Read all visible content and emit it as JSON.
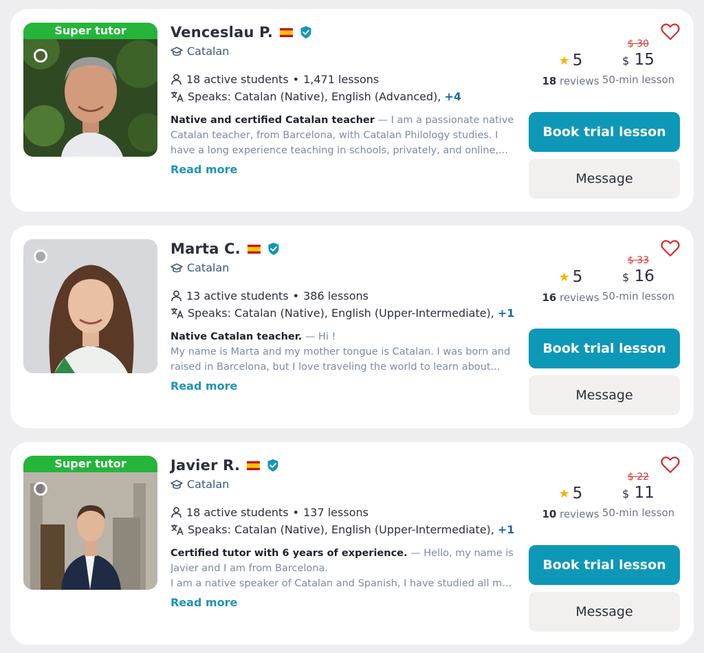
{
  "tutors": [
    {
      "super_tutor": "Super tutor",
      "name": "Venceslau P.",
      "subject": "Catalan",
      "active_students": "18 active students",
      "separator": "•",
      "lessons": "1,471 lessons",
      "speaks": "Speaks: Catalan (Native), English (Advanced),",
      "more_languages": "+4",
      "headline": "Native and certified Catalan teacher",
      "bio_line1": " — I am a passionate native",
      "bio_line2": "Catalan teacher, from Barcelona, with Catalan Philology studies. I",
      "bio_line3": "have a long experience teaching in schools, privately, and online,...",
      "read_more": "Read more",
      "rating": "5",
      "reviews_count": "18",
      "reviews_label": "reviews",
      "old_price": "$ 30",
      "currency": "$",
      "price": "15",
      "duration": "50-min lesson",
      "book_label": "Book trial lesson",
      "message_label": "Message"
    },
    {
      "super_tutor": "",
      "name": "Marta C.",
      "subject": "Catalan",
      "active_students": "13 active students",
      "separator": "•",
      "lessons": "386 lessons",
      "speaks": "Speaks: Catalan (Native), English (Upper-Intermediate),",
      "more_languages": "+1",
      "headline": "Native Catalan teacher.",
      "bio_line1": " — Hi !",
      "bio_line2": "My name is Marta and my mother tongue is Catalan. I was born and",
      "bio_line3": "raised in Barcelona, but I love traveling the world to learn about...",
      "read_more": "Read more",
      "rating": "5",
      "reviews_count": "16",
      "reviews_label": "reviews",
      "old_price": "$ 33",
      "currency": "$",
      "price": "16",
      "duration": "50-min lesson",
      "book_label": "Book trial lesson",
      "message_label": "Message"
    },
    {
      "super_tutor": "Super tutor",
      "name": "Javier R.",
      "subject": "Catalan",
      "active_students": "18 active students",
      "separator": "•",
      "lessons": "137 lessons",
      "speaks": "Speaks: Catalan (Native), English (Upper-Intermediate),",
      "more_languages": "+1",
      "headline": "Certified tutor with 6 years of experience.",
      "bio_line1": " — Hello, my name is",
      "bio_line2": "Javier and I am from Barcelona.",
      "bio_line3": "I am a native speaker of Catalan and Spanish, I have studied all m...",
      "read_more": "Read more",
      "rating": "5",
      "reviews_count": "10",
      "reviews_label": "reviews",
      "old_price": "$ 22",
      "currency": "$",
      "price": "11",
      "duration": "50-min lesson",
      "book_label": "Book trial lesson",
      "message_label": "Message"
    }
  ],
  "icons": {
    "flag": "spain-flag-icon",
    "verified": "verified-shield-icon",
    "subject": "graduation-cap-icon",
    "students": "person-icon",
    "languages": "translate-icon",
    "star": "star-icon",
    "favorite": "heart-icon"
  },
  "colors": {
    "brand_button": "#0e98b7",
    "super_tutor_badge": "#25b53a",
    "old_price": "#dd3333",
    "star": "#f6b400",
    "heart": "#d62b2b",
    "link": "#1f93b4"
  }
}
